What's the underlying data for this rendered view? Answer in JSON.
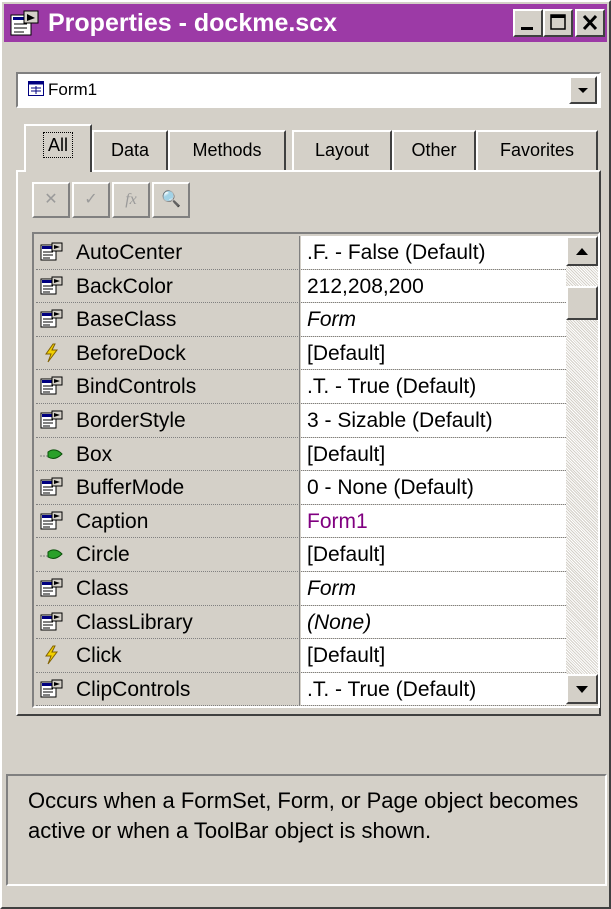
{
  "window": {
    "title": "Properties - dockme.scx",
    "accent_color": "#9c3aa6"
  },
  "object_combo": {
    "value": "Form1",
    "icon": "form-icon"
  },
  "tabs": [
    {
      "label": "All",
      "active": true
    },
    {
      "label": "Data",
      "active": false
    },
    {
      "label": "Methods",
      "active": false
    },
    {
      "label": "Layout",
      "active": false
    },
    {
      "label": "Other",
      "active": false
    },
    {
      "label": "Favorites",
      "active": false
    }
  ],
  "toolbar": [
    {
      "name": "cancel",
      "icon": "x-icon",
      "glyph": "✕"
    },
    {
      "name": "accept",
      "icon": "checkmark-icon",
      "glyph": "✓"
    },
    {
      "name": "function",
      "icon": "fx-icon",
      "glyph": "fx"
    },
    {
      "name": "zoom",
      "icon": "magnifier-icon",
      "glyph": "🔍"
    }
  ],
  "properties": [
    {
      "name": "AutoCenter",
      "value": ".F. - False (Default)",
      "kind": "property",
      "style": "normal"
    },
    {
      "name": "BackColor",
      "value": "212,208,200",
      "kind": "property",
      "style": "normal"
    },
    {
      "name": "BaseClass",
      "value": "Form",
      "kind": "property",
      "style": "italic"
    },
    {
      "name": "BeforeDock",
      "value": "[Default]",
      "kind": "event",
      "style": "normal"
    },
    {
      "name": "BindControls",
      "value": ".T. - True (Default)",
      "kind": "property",
      "style": "normal"
    },
    {
      "name": "BorderStyle",
      "value": "3 - Sizable (Default)",
      "kind": "property",
      "style": "normal"
    },
    {
      "name": "Box",
      "value": "[Default]",
      "kind": "method",
      "style": "normal"
    },
    {
      "name": "BufferMode",
      "value": "0 - None (Default)",
      "kind": "property",
      "style": "normal"
    },
    {
      "name": "Caption",
      "value": "Form1",
      "kind": "property",
      "style": "purple"
    },
    {
      "name": "Circle",
      "value": "[Default]",
      "kind": "method",
      "style": "normal"
    },
    {
      "name": "Class",
      "value": "Form",
      "kind": "property",
      "style": "italic"
    },
    {
      "name": "ClassLibrary",
      "value": "(None)",
      "kind": "property",
      "style": "italic"
    },
    {
      "name": "Click",
      "value": "[Default]",
      "kind": "event",
      "style": "normal"
    },
    {
      "name": "ClipControls",
      "value": ".T. - True (Default)",
      "kind": "property",
      "style": "normal"
    }
  ],
  "description": "Occurs when a FormSet, Form, or Page object becomes active or when a ToolBar object is shown."
}
